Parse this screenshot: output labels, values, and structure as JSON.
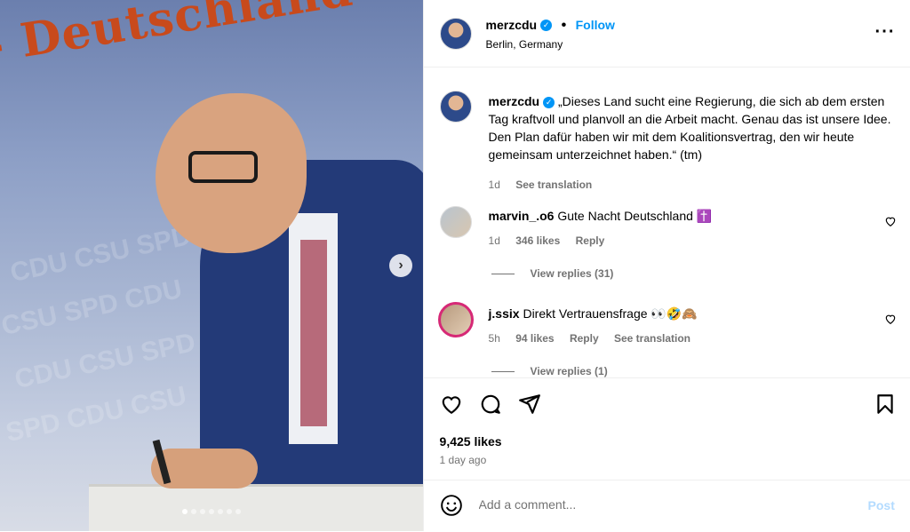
{
  "post": {
    "username": "merzcdu",
    "follow_label": "Follow",
    "location": "Berlin, Germany",
    "caption": "„Dieses Land sucht eine Regierung, die sich ab dem ersten Tag kraftvoll und planvoll an die Arbeit macht. Genau das ist unsere Idee. Den Plan dafür haben wir mit dem Koalitionsvertrag, den wir heute gemeinsam unterzeichnet haben.“ (tm)",
    "caption_age": "1d",
    "see_translation": "See translation",
    "likes": "9,425 likes",
    "posted_ago": "1 day ago",
    "media_banner": "- Deutschland",
    "media_watermark": [
      "CDU CSU SPD",
      "CSU SPD CDU",
      "CDU CSU SPD",
      "SPD CDU CSU"
    ],
    "carousel_count": 7,
    "carousel_active": 1
  },
  "comments": [
    {
      "username": "marvin_.o6",
      "text": "Gute Nacht Deutschland ✝️",
      "age": "1d",
      "likes": "346 likes",
      "reply": "Reply",
      "view_replies": "View replies (31)"
    },
    {
      "username": "j.ssix",
      "text": "Direkt Vertrauensfrage 👀🤣🙈",
      "age": "5h",
      "likes": "94 likes",
      "reply": "Reply",
      "see_translation": "See translation",
      "view_replies": "View replies (1)"
    }
  ],
  "composer": {
    "placeholder": "Add a comment...",
    "post_label": "Post"
  }
}
